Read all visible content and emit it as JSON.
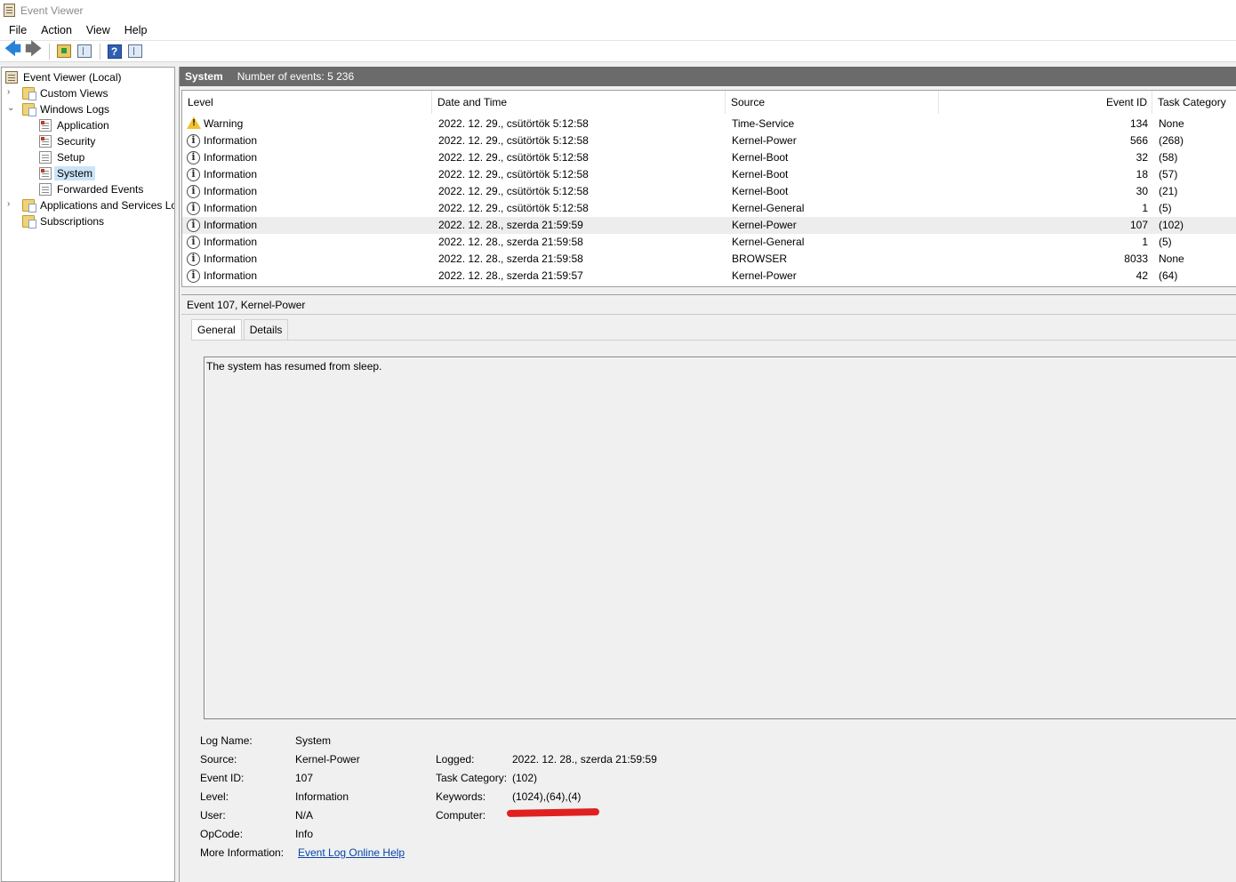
{
  "window": {
    "title": "Event Viewer"
  },
  "menu": [
    "File",
    "Action",
    "View",
    "Help"
  ],
  "toolbar": {
    "buttons": [
      "back-arrow-icon",
      "forward-arrow-icon",
      "open-folder-icon",
      "show-pane-icon",
      "help-icon",
      "properties-pane-icon"
    ]
  },
  "tree": {
    "root": "Event Viewer (Local)",
    "custom_views": "Custom Views",
    "windows_logs": "Windows Logs",
    "application": "Application",
    "security": "Security",
    "setup": "Setup",
    "system": "System",
    "forwarded": "Forwarded Events",
    "apps_services": "Applications and Services Lo",
    "subscriptions": "Subscriptions"
  },
  "list": {
    "log_name": "System",
    "count_text": "Number of events: 5 236",
    "columns": {
      "level": "Level",
      "datetime": "Date and Time",
      "source": "Source",
      "event_id": "Event ID",
      "task_category": "Task Category"
    },
    "rows": [
      {
        "level": "Warning",
        "datetime": "2022. 12. 29., csütörtök 5:12:58",
        "source": "Time-Service",
        "event_id": "134",
        "task": "None"
      },
      {
        "level": "Information",
        "datetime": "2022. 12. 29., csütörtök 5:12:58",
        "source": "Kernel-Power",
        "event_id": "566",
        "task": "(268)"
      },
      {
        "level": "Information",
        "datetime": "2022. 12. 29., csütörtök 5:12:58",
        "source": "Kernel-Boot",
        "event_id": "32",
        "task": "(58)"
      },
      {
        "level": "Information",
        "datetime": "2022. 12. 29., csütörtök 5:12:58",
        "source": "Kernel-Boot",
        "event_id": "18",
        "task": "(57)"
      },
      {
        "level": "Information",
        "datetime": "2022. 12. 29., csütörtök 5:12:58",
        "source": "Kernel-Boot",
        "event_id": "30",
        "task": "(21)"
      },
      {
        "level": "Information",
        "datetime": "2022. 12. 29., csütörtök 5:12:58",
        "source": "Kernel-General",
        "event_id": "1",
        "task": "(5)"
      },
      {
        "level": "Information",
        "datetime": "2022. 12. 28., szerda 21:59:59",
        "source": "Kernel-Power",
        "event_id": "107",
        "task": "(102)"
      },
      {
        "level": "Information",
        "datetime": "2022. 12. 28., szerda 21:59:58",
        "source": "Kernel-General",
        "event_id": "1",
        "task": "(5)"
      },
      {
        "level": "Information",
        "datetime": "2022. 12. 28., szerda 21:59:58",
        "source": "BROWSER",
        "event_id": "8033",
        "task": "None"
      },
      {
        "level": "Information",
        "datetime": "2022. 12. 28., szerda 21:59:57",
        "source": "Kernel-Power",
        "event_id": "42",
        "task": "(64)"
      }
    ]
  },
  "detail": {
    "header": "Event 107, Kernel-Power",
    "tabs": {
      "general": "General",
      "details": "Details"
    },
    "description": "The system has resumed from sleep.",
    "labels": {
      "log_name": "Log Name:",
      "source": "Source:",
      "event_id": "Event ID:",
      "level": "Level:",
      "user": "User:",
      "opcode": "OpCode:",
      "more_info": "More Information:",
      "logged": "Logged:",
      "task_category": "Task Category:",
      "keywords": "Keywords:",
      "computer": "Computer:"
    },
    "values": {
      "log_name": "System",
      "source": "Kernel-Power",
      "event_id": "107",
      "level": "Information",
      "user": "N/A",
      "opcode": "Info",
      "more_info_link": "Event Log Online Help",
      "logged": "2022. 12. 28., szerda 21:59:59",
      "task_category": "(102)",
      "keywords": "(1024),(64),(4)"
    }
  },
  "colors": {
    "selection": "#cce4f7",
    "header_bar": "#6b6b6b",
    "link": "#0645ad",
    "redaction": "#e02020"
  }
}
